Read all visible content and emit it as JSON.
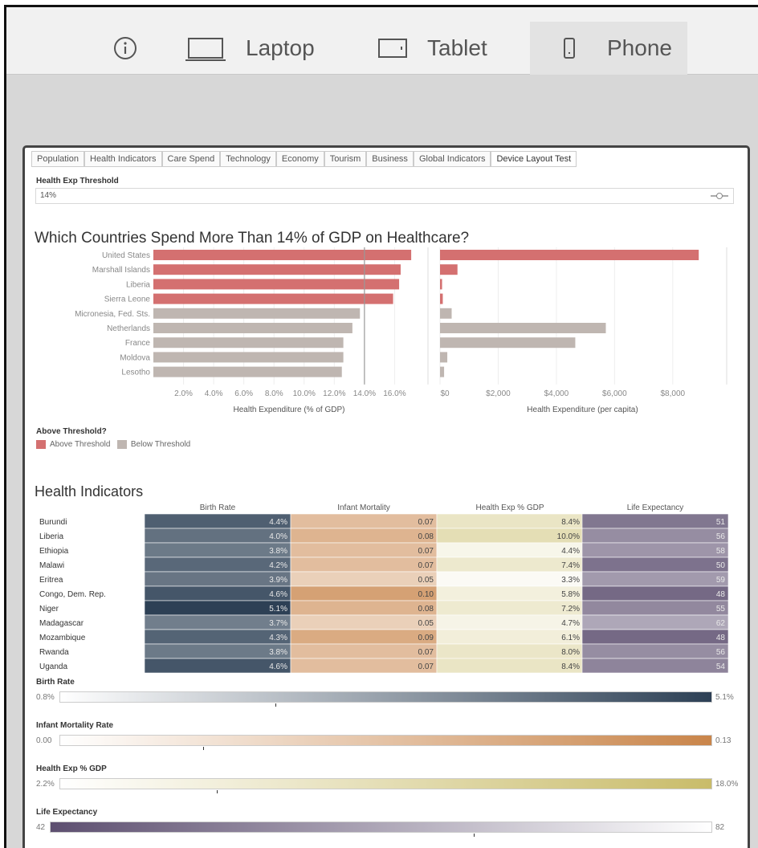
{
  "toolbar": {
    "info_icon": "info-circle-icon",
    "laptop_label": "Laptop",
    "tablet_label": "Tablet",
    "phone_label": "Phone"
  },
  "dashboard": {
    "tabs": [
      "Population",
      "Health Indicators",
      "Care Spend",
      "Technology",
      "Economy",
      "Tourism",
      "Business",
      "Global Indicators",
      "Device Layout Test"
    ],
    "active_tab": "Device Layout Test",
    "parameter": {
      "label": "Health Exp Threshold",
      "value": "14%"
    },
    "title": "Which Countries Spend More Than 14% of GDP on Healthcare?",
    "legend": {
      "title": "Above Threshold?",
      "items": [
        {
          "label": "Above Threshold",
          "color": "#d47070"
        },
        {
          "label": "Below Threshold",
          "color": "#bfb6b1"
        }
      ]
    },
    "heatmap_title": "Health Indicators",
    "scales": [
      {
        "label": "Birth Rate",
        "min": "0.8%",
        "max": "5.1%",
        "colors": [
          "#ffffff",
          "#2d4055"
        ],
        "marker": 0.33
      },
      {
        "label": "Infant Mortality Rate",
        "min": "0.00",
        "max": "0.13",
        "colors": [
          "#ffffff",
          "#c9854a"
        ],
        "marker": 0.22
      },
      {
        "label": "Health Exp % GDP",
        "min": "2.2%",
        "max": "18.0%",
        "colors": [
          "#ffffff",
          "#c9bc6a"
        ],
        "marker": 0.24
      },
      {
        "label": "Life Expectancy",
        "min": "42",
        "max": "82",
        "colors": [
          "#5d4f70",
          "#ffffff"
        ],
        "marker": 0.64
      }
    ]
  },
  "chart_data": [
    {
      "type": "bar",
      "orientation": "horizontal",
      "categories": [
        "United States",
        "Marshall Islands",
        "Liberia",
        "Sierra Leone",
        "Micronesia, Fed. Sts.",
        "Netherlands",
        "France",
        "Moldova",
        "Lesotho"
      ],
      "values": [
        17.1,
        16.4,
        16.3,
        15.9,
        13.7,
        13.2,
        12.6,
        12.6,
        12.5
      ],
      "above_threshold": [
        true,
        true,
        true,
        true,
        false,
        false,
        false,
        false,
        false
      ],
      "threshold": 14,
      "xlabel": "Health Expenditure (% of GDP)",
      "ticks": [
        "2.0%",
        "4.0%",
        "6.0%",
        "8.0%",
        "10.0%",
        "12.0%",
        "14.0%",
        "16.0%"
      ],
      "xlim": [
        0,
        18
      ]
    },
    {
      "type": "bar",
      "orientation": "horizontal",
      "categories": [
        "United States",
        "Marshall Islands",
        "Liberia",
        "Sierra Leone",
        "Micronesia, Fed. Sts.",
        "Netherlands",
        "France",
        "Moldova",
        "Lesotho"
      ],
      "values": [
        8895,
        600,
        70,
        95,
        400,
        5700,
        4650,
        250,
        140
      ],
      "xlabel": "Health Expenditure (per capita)",
      "ticks": [
        "$0",
        "$2,000",
        "$4,000",
        "$6,000",
        "$8,000"
      ],
      "xlim": [
        0,
        9800
      ]
    },
    {
      "type": "heatmap",
      "columns": [
        "Birth Rate",
        "Infant Mortality",
        "Health Exp % GDP",
        "Life Expectancy"
      ],
      "rows": [
        {
          "country": "Burundi",
          "values": [
            "4.4%",
            "0.07",
            "8.4%",
            "51"
          ]
        },
        {
          "country": "Liberia",
          "values": [
            "4.0%",
            "0.08",
            "10.0%",
            "56"
          ]
        },
        {
          "country": "Ethiopia",
          "values": [
            "3.8%",
            "0.07",
            "4.4%",
            "58"
          ]
        },
        {
          "country": "Malawi",
          "values": [
            "4.2%",
            "0.07",
            "7.4%",
            "50"
          ]
        },
        {
          "country": "Eritrea",
          "values": [
            "3.9%",
            "0.05",
            "3.3%",
            "59"
          ]
        },
        {
          "country": "Congo, Dem. Rep.",
          "values": [
            "4.6%",
            "0.10",
            "5.8%",
            "48"
          ]
        },
        {
          "country": "Niger",
          "values": [
            "5.1%",
            "0.08",
            "7.2%",
            "55"
          ]
        },
        {
          "country": "Madagascar",
          "values": [
            "3.7%",
            "0.05",
            "4.7%",
            "62"
          ]
        },
        {
          "country": "Mozambique",
          "values": [
            "4.3%",
            "0.09",
            "6.1%",
            "48"
          ]
        },
        {
          "country": "Rwanda",
          "values": [
            "3.8%",
            "0.07",
            "8.0%",
            "56"
          ]
        },
        {
          "country": "Uganda",
          "values": [
            "4.6%",
            "0.07",
            "8.4%",
            "54"
          ]
        }
      ]
    }
  ]
}
